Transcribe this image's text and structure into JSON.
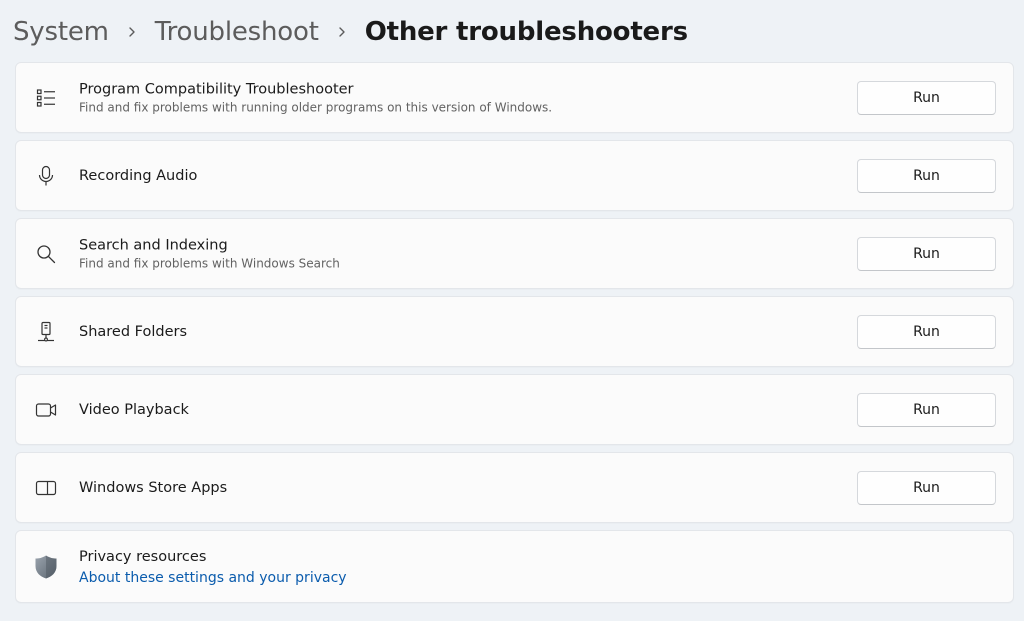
{
  "breadcrumb": {
    "items": [
      "System",
      "Troubleshoot"
    ],
    "current": "Other troubleshooters"
  },
  "troubleshooters": [
    {
      "icon": "list-icon",
      "title": "Program Compatibility Troubleshooter",
      "description": "Find and fix problems with running older programs on this version of Windows.",
      "button": "Run"
    },
    {
      "icon": "microphone-icon",
      "title": "Recording Audio",
      "description": "",
      "button": "Run"
    },
    {
      "icon": "search-icon",
      "title": "Search and Indexing",
      "description": "Find and fix problems with Windows Search",
      "button": "Run"
    },
    {
      "icon": "shared-folder-icon",
      "title": "Shared Folders",
      "description": "",
      "button": "Run"
    },
    {
      "icon": "video-camera-icon",
      "title": "Video Playback",
      "description": "",
      "button": "Run"
    },
    {
      "icon": "store-apps-icon",
      "title": "Windows Store Apps",
      "description": "",
      "button": "Run"
    }
  ],
  "privacy": {
    "icon": "shield-icon",
    "title": "Privacy resources",
    "link": "About these settings and your privacy"
  },
  "colors": {
    "accent_link": "#0b5cad",
    "page_background": "#eef2f6",
    "card_background": "#fbfbfb"
  }
}
